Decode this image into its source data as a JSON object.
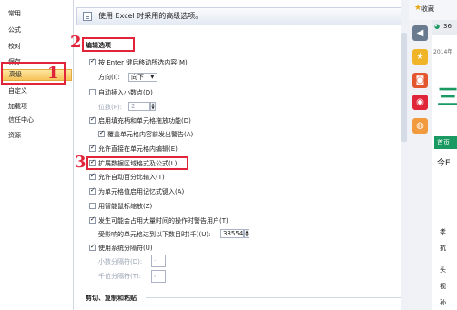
{
  "left_nav": {
    "items": [
      {
        "label": "常用"
      },
      {
        "label": "公式"
      },
      {
        "label": "校对"
      },
      {
        "label": "保存"
      },
      {
        "label": "高级"
      },
      {
        "label": "自定义"
      },
      {
        "label": "加载项"
      },
      {
        "label": "信任中心"
      },
      {
        "label": "资源"
      }
    ],
    "selected_index": 4
  },
  "annotations": {
    "n1": "1",
    "n2": "2",
    "n3": "3"
  },
  "header": {
    "text": "使用 Excel 时采用的高级选项。"
  },
  "edit_section": {
    "title": "编辑选项",
    "move_after_enter": {
      "label": "按 Enter 键后移动所选内容(M)",
      "checked": true
    },
    "direction": {
      "label": "方向(I):",
      "value": "向下"
    },
    "auto_decimal": {
      "label": "自动插入小数点(D)",
      "checked": false
    },
    "places": {
      "label": "位数(P):",
      "value": "2"
    },
    "fill_handle": {
      "label": "启用填充柄和单元格拖放功能(D)",
      "checked": true
    },
    "alert_overwrite": {
      "label": "覆盖单元格内容前发出警告(A)",
      "checked": true
    },
    "edit_in_cell": {
      "label": "允许直接在单元格内编辑(E)",
      "checked": true
    },
    "extend_formats": {
      "label": "扩展数据区域格式及公式(L)",
      "checked": true
    },
    "auto_percent": {
      "label": "允许自动百分比输入(T)",
      "checked": true
    },
    "autocomplete": {
      "label": "为单元格值启用记忆式键入(A)",
      "checked": true
    },
    "intellimouse": {
      "label": "用智能鼠标缩放(Z)",
      "checked": false
    },
    "alert_slow": {
      "label": "发生可能会占用大量时间的操作时警告用户(T)",
      "checked": true
    },
    "cells_threshold": {
      "label": "受影响的单元格达到以下数目时(千)(U):",
      "value": "33554"
    },
    "system_separators": {
      "label": "使用系统分隔符(U)",
      "checked": true
    },
    "decimal_sep": {
      "label": "小数分隔符(D):",
      "value": "."
    },
    "thousands_sep": {
      "label": "千位分隔符(T):",
      "value": ","
    }
  },
  "cut_section": {
    "title": "剪切、复制和粘贴"
  },
  "right_panel": {
    "favorites_label": "收藏",
    "tab_label": "36",
    "home_label": "首页",
    "snippets": [
      "2014年",
      "今E",
      "孝",
      "抗",
      "头",
      "视",
      "孙"
    ]
  },
  "colors": {
    "annotation_red": "#e0253a",
    "selected_nav": "#f7c35a",
    "browser_green": "#1a9a62"
  }
}
